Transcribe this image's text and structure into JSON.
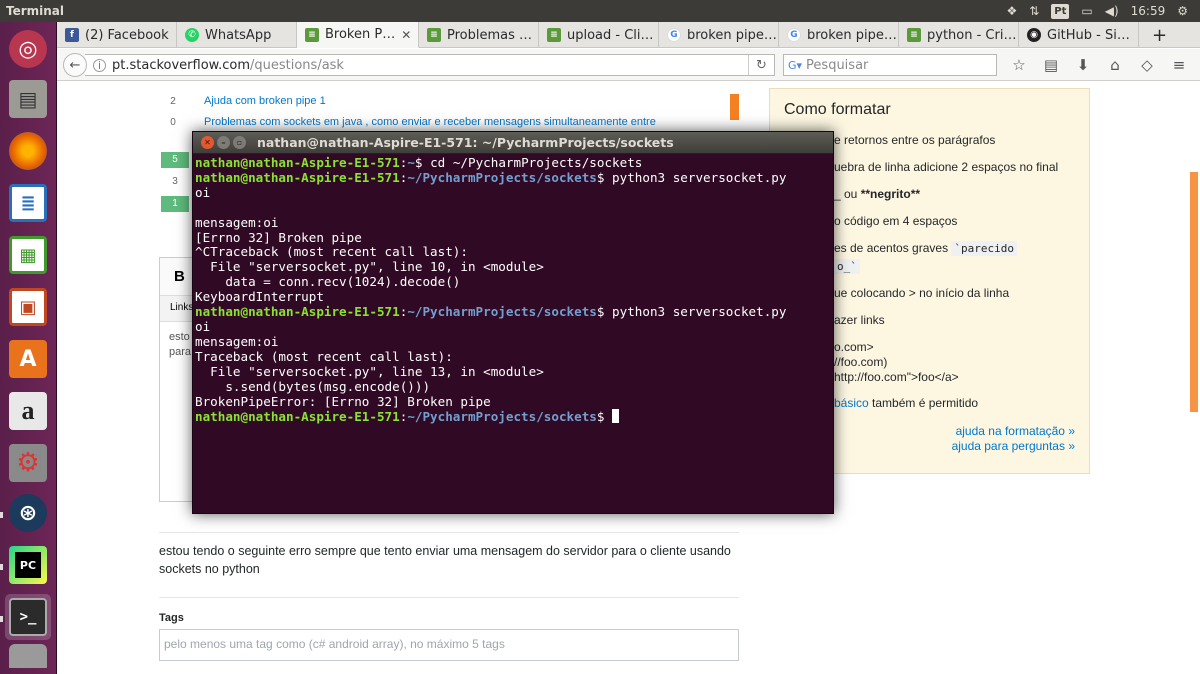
{
  "topbar": {
    "app_title": "Terminal",
    "clock": "16:59",
    "keyboard_layout": "Pt",
    "icons": [
      "dropbox-icon",
      "network-updown-icon",
      "keyboard-layout-icon",
      "battery-icon",
      "volume-icon",
      "gear-icon"
    ]
  },
  "launcher": {
    "items": [
      {
        "name": "ubuntu-dash-icon",
        "color": "#e95420"
      },
      {
        "name": "files-icon",
        "color": "#8c8a84"
      },
      {
        "name": "firefox-icon",
        "color": "#e66000"
      },
      {
        "name": "libreoffice-writer-icon",
        "color": "#2a6fba"
      },
      {
        "name": "libreoffice-calc-icon",
        "color": "#3f9a2b"
      },
      {
        "name": "libreoffice-impress-icon",
        "color": "#c0471f"
      },
      {
        "name": "software-center-icon",
        "color": "#e9731d"
      },
      {
        "name": "amazon-icon",
        "color": "#d9d9d9"
      },
      {
        "name": "system-settings-icon",
        "color": "#b33c2e"
      },
      {
        "name": "steam-icon",
        "color": "#1b3a5c"
      },
      {
        "name": "pycharm-icon",
        "color": "#21d789"
      },
      {
        "name": "terminal-icon",
        "color": "#3a3a3a"
      }
    ]
  },
  "browser": {
    "tabs": [
      {
        "label": "(2) Facebook",
        "icon": "facebook-icon"
      },
      {
        "label": "WhatsApp",
        "icon": "whatsapp-icon"
      },
      {
        "label": "Broken P…",
        "icon": "stackoverflow-icon",
        "active": true
      },
      {
        "label": "Problemas …",
        "icon": "stackoverflow-icon"
      },
      {
        "label": "upload - Cli…",
        "icon": "stackoverflow-icon"
      },
      {
        "label": "broken pipe…",
        "icon": "google-icon"
      },
      {
        "label": "broken pipe…",
        "icon": "google-icon"
      },
      {
        "label": "python - Cri…",
        "icon": "stackoverflow-icon"
      },
      {
        "label": "GitHub - Si…",
        "icon": "github-icon"
      }
    ],
    "new_tab": "+",
    "url_host": "pt.stackoverflow.com",
    "url_path": "/questions/ask",
    "search_placeholder": "Pesquisar"
  },
  "page": {
    "related": [
      {
        "count": "2",
        "title": "Ajuda com broken pipe 1"
      },
      {
        "count": "0",
        "title": "Problemas com sockets em java , como enviar e receber mensagens simultaneamente entre"
      },
      {
        "count": "5",
        "answered": true
      },
      {
        "count": "3"
      },
      {
        "count": "1",
        "answered": true
      }
    ],
    "editor": {
      "bold_label": "B",
      "link_label": "Links",
      "text_line1": "esto",
      "text_line2": "para"
    },
    "preview_text": "estou tendo o seguinte erro sempre que tento enviar uma mensagem do servidor para o cliente usando sockets no python",
    "tags_label": "Tags",
    "tags_placeholder": "pelo menos uma tag como (c# android array), no máximo 5 tags"
  },
  "help": {
    "title": "Como formatar",
    "lines": [
      "e retornos entre os parágrafos",
      "uebra de linha adicione 2 espaços no final",
      "o código em 4 espaços",
      "es de acentos graves",
      "ue colocando > no início da linha",
      "azer links",
      "o.com>",
      "//foo.com)",
      "http://foo.com\">foo</a>",
      "também é permitido"
    ],
    "italic_bold_prefix": "_ ou ",
    "bold_sample": "**negrito**",
    "code_sample1": "`parecido",
    "code_sample2": "o_`",
    "basic_link": "básico",
    "format_link": "ajuda na formatação »",
    "questions_link": "ajuda para perguntas »"
  },
  "terminal": {
    "title": "nathan@nathan-Aspire-E1-571: ~/PycharmProjects/sockets",
    "user_host": "nathan@nathan-Aspire-E1-571",
    "home": "~",
    "cwd": "~/PycharmProjects/sockets",
    "cmd_cd": " cd ~/PycharmProjects/sockets",
    "cmd_run": " python3 serversocket.py",
    "out1": "oi\n\nmensagem:oi\n[Errno 32] Broken pipe\n^CTraceback (most recent call last):\n  File \"serversocket.py\", line 10, in <module>\n    data = conn.recv(1024).decode()\nKeyboardInterrupt",
    "out2": "oi\nmensagem:oi\nTraceback (most recent call last):\n  File \"serversocket.py\", line 13, in <module>\n    s.send(bytes(msg.encode()))\nBrokenPipeError: [Errno 32] Broken pipe"
  }
}
